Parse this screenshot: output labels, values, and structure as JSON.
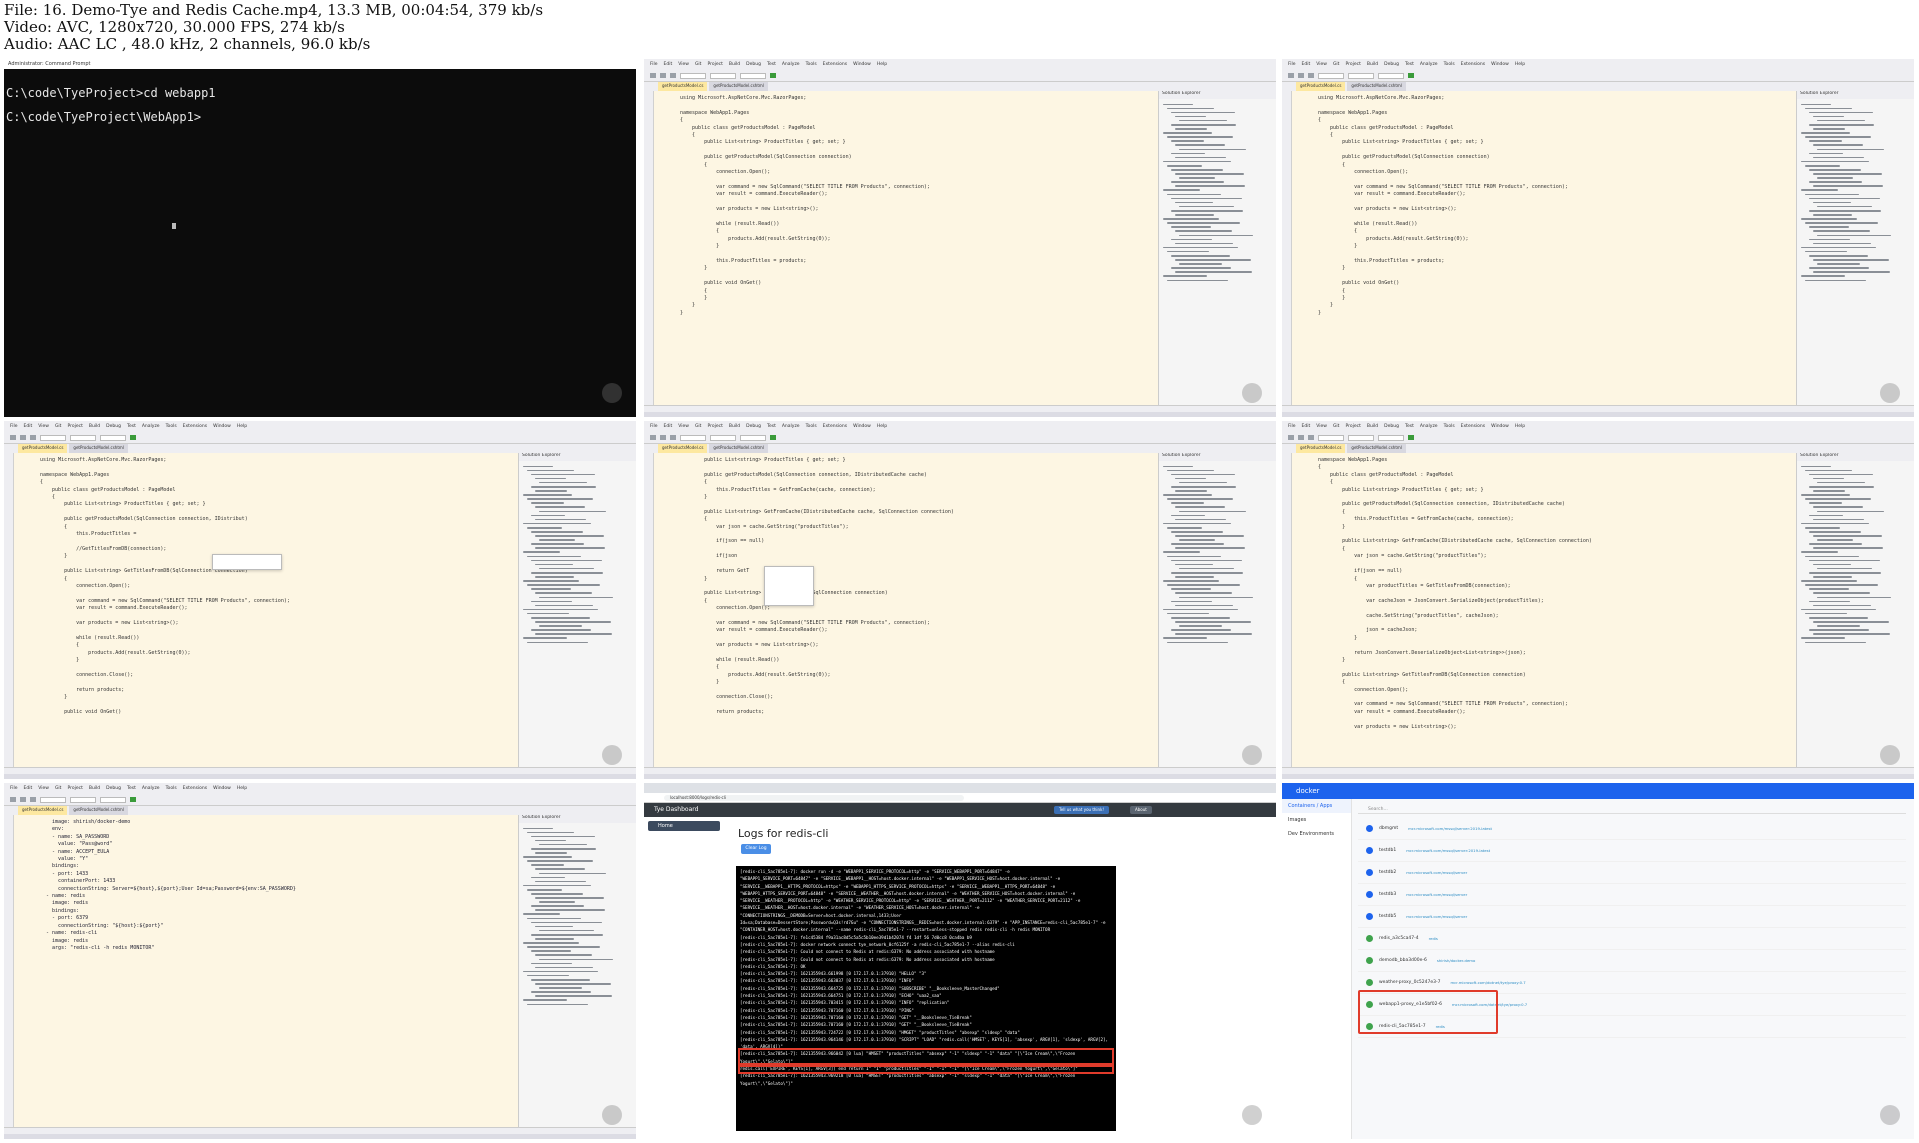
{
  "info": {
    "line1": "File: 16. Demo-Tye and Redis Cache.mp4, 13.3 MB, 00:04:54, 379 kb/s",
    "line2": "Video: AVC, 1280x720, 30.000 FPS, 274 kb/s",
    "line3": "Audio: AAC LC , 48.0 kHz, 2 channels, 96.0 kb/s"
  },
  "terminal": {
    "title": "Administrator: Command Prompt",
    "lines": [
      "C:\\code\\TyeProject>cd webapp1",
      "C:\\code\\TyeProject\\WebApp1>"
    ]
  },
  "vs": {
    "menu": [
      "File",
      "Edit",
      "View",
      "Git",
      "Project",
      "Build",
      "Debug",
      "Test",
      "Analyze",
      "Tools",
      "Extensions",
      "Window",
      "Help"
    ],
    "tab_active": "getProductsModel.cs",
    "tab_other": "getProductsModel.cshtml",
    "explorer_title": "Solution Explorer"
  },
  "code": {
    "frame2": "using Microsoft.AspNetCore.Mvc.RazorPages;\n\nnamespace WebApp1.Pages\n{\n    public class getProductsModel : PageModel\n    {\n        public List<string> ProductTitles { get; set; }\n\n        public getProductsModel(SqlConnection connection)\n        {\n            connection.Open();\n\n            var command = new SqlCommand(\"SELECT TITLE FROM Products\", connection);\n            var result = command.ExecuteReader();\n\n            var products = new List<string>();\n\n            while (result.Read())\n            {\n                products.Add(result.GetString(0));\n            }\n\n            this.ProductTitles = products;\n        }\n\n        public void OnGet()\n        {\n        }\n    }\n}",
    "frame4": "using Microsoft.AspNetCore.Mvc.RazorPages;\n\nnamespace WebApp1.Pages\n{\n    public class getProductsModel : PageModel\n    {\n        public List<string> ProductTitles { get; set; }\n\n        public getProductsModel(SqlConnection connection, IDistribut)\n        {\n            this.ProductTitles =\n\n            //GetTitlesFromDB(connection);\n        }\n\n        public List<string> GetTitlesFromDB(SqlConnection connection)\n        {\n            connection.Open();\n\n            var command = new SqlCommand(\"SELECT TITLE FROM Products\", connection);\n            var result = command.ExecuteReader();\n\n            var products = new List<string>();\n\n            while (result.Read())\n            {\n                products.Add(result.GetString(0));\n            }\n\n            connection.Close();\n\n            return products;\n        }\n\n        public void OnGet()",
    "frame5": "        public List<string> ProductTitles { get; set; }\n\n        public getProductsModel(SqlConnection connection, IDistributedCache cache)\n        {\n            this.ProductTitles = GetFromCache(cache, connection);\n        }\n\n        public List<string> GetFromCache(IDistributedCache cache, SqlConnection connection)\n        {\n            var json = cache.GetString(\"productTitles\");\n\n            if(json == null)\n\n            if(json\n\n            return GetT\n        }\n\n        public List<string> GetTitlesFromDB(SqlConnection connection)\n        {\n            connection.Open();\n\n            var command = new SqlCommand(\"SELECT TITLE FROM Products\", connection);\n            var result = command.ExecuteReader();\n\n            var products = new List<string>();\n\n            while (result.Read())\n            {\n                products.Add(result.GetString(0));\n            }\n\n            connection.Close();\n\n            return products;",
    "frame6": "namespace WebApp1.Pages\n{\n    public class getProductsModel : PageModel\n    {\n        public List<string> ProductTitles { get; set; }\n\n        public getProductsModel(SqlConnection connection, IDistributedCache cache)\n        {\n            this.ProductTitles = GetFromCache(cache, connection);\n        }\n\n        public List<string> GetFromCache(IDistributedCache cache, SqlConnection connection)\n        {\n            var json = cache.GetString(\"productTitles\");\n\n            if(json == null)\n            {\n                var productTitles = GetTitlesFromDB(connection);\n\n                var cacheJson = JsonConvert.SerializeObject(productTitles);\n\n                cache.SetString(\"productTitles\", cacheJson);\n\n                json = cacheJson;\n            }\n\n            return JsonConvert.DeserializeObject<List<string>>(json);\n        }\n\n        public List<string> GetTitlesFromDB(SqlConnection connection)\n        {\n            connection.Open();\n\n            var command = new SqlCommand(\"SELECT TITLE FROM Products\", connection);\n            var result = command.ExecuteReader();\n\n            var products = new List<string>();",
    "frame7": "    image: shirish/docker-demo\n    env:\n    - name: SA_PASSWORD\n      value: \"Pass@word\"\n    - name: ACCEPT_EULA\n      value: \"Y\"\n    bindings:\n    - port: 1433\n      containerPort: 1433\n      connectionString: Server=${host},${port};User Id=sa;Password=${env:SA_PASSWORD}\n  - name: redis\n    image: redis\n    bindings:\n    - port: 6379\n      connectionString: \"${host}:${port}\"\n  - name: redis-cli\n    image: redis\n    args: \"redis-cli -h redis MONITOR\""
  },
  "tye": {
    "url": "localhost:8000/logs/redis-cli",
    "brand": "Tye Dashboard",
    "feedback": "Tell us what you think!",
    "about": "About",
    "nav_home": "Home",
    "page_title": "Logs for redis-cli",
    "clear": "Clear Log",
    "log_lines": [
      "[redis-cli_5ac785e1-7]: docker run -d -e \"WEBAPP1_SERVICE_PROTOCOL=http\" -e \"SERVICE_WEBAPP1_PORT=64847\" -e",
      "\"WEBAPP1_SERVICE_PORT=64847\" -e \"SERVICE__WEBAPP1__HOST=host.docker.internal\" -e \"WEBAPP1_SERVICE_HOST=host.docker.internal\" -e",
      "\"SERVICE__WEBAPP1__HTTPS_PROTOCOL=https\" -e \"WEBAPP1_HTTPS_SERVICE_PROTOCOL=https\" -e \"SERVICE__WEBAPP1__HTTPS_PORT=64848\" -e",
      "\"WEBAPP1_HTTPS_SERVICE_PORT=64848\" -e \"SERVICE__WEATHER__HOST=host.docker.internal\" -e \"WEATHER_SERVICE_HOST=host.docker.internal\" -e",
      "\"SERVICE__WEATHER__PROTOCOL=http\" -e \"WEATHER_SERVICE_PROTOCOL=http\" -e \"SERVICE__WEATHER__PORT=2112\" -e \"WEATHER_SERVICE_PORT=2112\" -e",
      "\"SERVICE__WEATHER__HOST=host.docker.internal\" -e \"WEATHER_SERVICE_HOST=host.docker.internal\" -e \"CONNECTIONSTRINGS__DEMODB=Server=host.docker.internal,1433;User",
      "Id=sa;Database=DessertStore;Password=Q3s!rd7Gu\" -e \"CONNECTIONSTRINGS__REDIS=host.docker.internal:6379\" -e \"APP_INSTANCE=redis-cli_5ac785e1-7\" -e",
      "\"CONTAINER_HOST=host.docker.internal\" --name redis-cli_5ac785e1-7 --restart=unless-stopped redis redis-cli -h redis MONITOR",
      "[redis-cli_5ac785e1-7]: fe1c45384 f9a31ac8d5c5a5c5b10ee39d1b42074 f4 1df 56 7d0cc8 0ca4ba b9",
      "[redis-cli_5ac785e1-7]: docker network connect tye_network_0cf6125f -a redis-cli_5ac785e1-7 --alias redis-cli",
      "[redis-cli_5ac785e1-7]: Could not connect to Redis at redis:6379: No address associated with hostname",
      "[redis-cli_5ac785e1-7]: Could not connect to Redis at redis:6379: No address associated with hostname",
      "[redis-cli_5ac785e1-7]: OK",
      "[redis-cli_5ac785e1-7]: 1621355943.661998 [0 172.17.0.1:37910] \"HELLO\" \"3\"",
      "[redis-cli_5ac785e1-7]: 1621355943.663037 [0 172.17.0.1:37910] \"INFO\"",
      "[redis-cli_5ac785e1-7]: 1621355943.664725 [0 172.17.0.1:37910] \"SUBSCRIBE\" \"__Booksleeve_MasterChanged\"",
      "[redis-cli_5ac785e1-7]: 1621355943.664751 [0 172.17.0.1:37910] \"ECHO\" \"uaa2_saa\"",
      "[redis-cli_5ac785e1-7]: 1621355943.703415 [0 172.17.0.1:37910] \"INFO\" \"replication\"",
      "[redis-cli_5ac785e1-7]: 1621355943.707160 [0 172.17.0.1:37910] \"PING\"",
      "[redis-cli_5ac785e1-7]: 1621355943.707160 [0 172.17.0.1:37910] \"GET\" \"__Booksleeve_TieBreak\"",
      "[redis-cli_5ac785e1-7]: 1621355943.707160 [0 172.17.0.1:37910] \"GET\" \"__Booksleeve_TieBreak\"",
      "[redis-cli_5ac785e1-7]: 1621355943.724722 [0 172.17.0.1:37910] \"HMGET\" \"productTitles\" \"absexp\" \"sldexp\" \"data\"",
      "[redis-cli_5ac785e1-7]: 1621355943.964146 [0 172.17.0.1:37910] \"SCRIPT\" \"LOAD\" \"redis.call('HMSET', KEYS[1], 'absexp', ARGV[1], 'sldexp', ARGV[2], 'data', ARGV[4])\"",
      "[redis-cli_5ac785e1-7]: 1621355943.966042 [0 lua] \"HMSET\" \"productTitles\" \"absexp\" \"-1\" \"sldexp\" \"-1\" \"data\" \"[\\\"Ice Cream\\\",\\\"Frozen Yogurt\\\",\\\"Gelato\\\"]\"",
      "redis.call('EXPIRE', KEYS[1], ARGV[3]) end return 1\" \"1\" \"productTitles\" \"-1\" \"-1\" \"-1\" \"[\\\"Ice Cream\\\",\\\"Frozen Yogurt\\\",\\\"Gelato\\\"]\"",
      "[redis-cli_5ac785e1-7]: 1621355943.969218 [0 lua] \"HMSET\" \"productTitles\" \"absexp\" \"-1\" \"sldexp\" \"-1\" \"data\" \"[\\\"Ice Cream\\\",\\\"Frozen Yogurt\\\",\\\"Gelato\\\"]\""
    ]
  },
  "docker": {
    "brand": "docker",
    "nav": [
      "Containers / Apps",
      "Images",
      "Dev Environments"
    ],
    "search_placeholder": "Search...",
    "containers": [
      {
        "name": "dbmgmt",
        "sub": "mcr.microsoft.com/mssql/server:2019-latest",
        "running": false
      },
      {
        "name": "testdb1",
        "sub": "mcr.microsoft.com/mssql/server:2019-latest",
        "running": false
      },
      {
        "name": "testdb2",
        "sub": "mcr.microsoft.com/mssql/server",
        "running": false
      },
      {
        "name": "testdb3",
        "sub": "mcr.microsoft.com/mssql/server",
        "running": false
      },
      {
        "name": "testdb5",
        "sub": "mcr.microsoft.com/mssql/server",
        "running": false
      },
      {
        "name": "redis_a3c5ca47-4",
        "sub": "redis",
        "running": true
      },
      {
        "name": "demodb_bba3d00e-6",
        "sub": "shirish/docker-demo",
        "running": true
      },
      {
        "name": "weather-proxy_0c5247e3-7",
        "sub": "mcr.microsoft.com/dotnet/tye/proxy:0.7",
        "running": true
      },
      {
        "name": "webapp1-proxy_e1e5bf02-6",
        "sub": "mcr.microsoft.com/dotnet/tye/proxy:0.7",
        "running": true
      },
      {
        "name": "redis-cli_5ac785e1-7",
        "sub": "redis",
        "running": true
      }
    ]
  }
}
